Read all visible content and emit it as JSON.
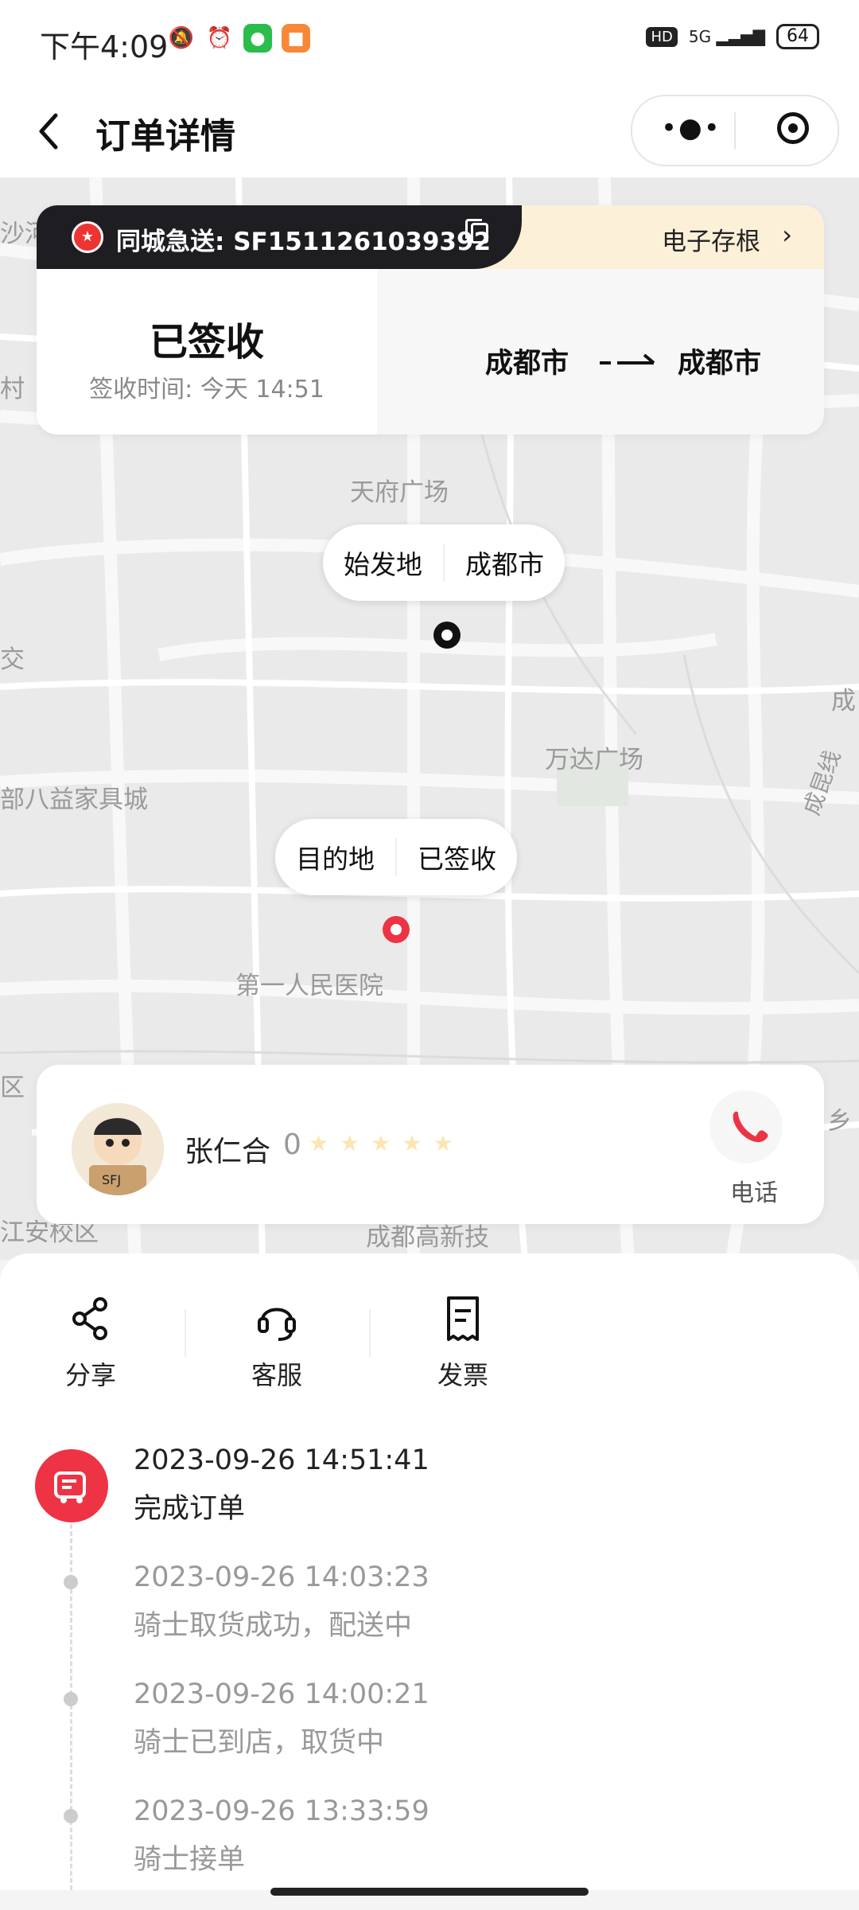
{
  "status_bar": {
    "time": "下午4:09",
    "hd": "HD",
    "network": "5G",
    "battery": "64",
    "icons": [
      "mute-icon",
      "alarm-icon",
      "wechat-icon",
      "app-icon"
    ]
  },
  "header": {
    "title": "订单详情",
    "back_icon": "chevron-left-icon",
    "more_icon": "more-dots-icon",
    "target_icon": "target-icon"
  },
  "order": {
    "code_label": "同城急送: SF1511261039392",
    "receipt_label": "电子存根",
    "status": "已签收",
    "sign_time": "签收时间: 今天 14:51",
    "from_city": "成都市",
    "to_city": "成都市"
  },
  "map": {
    "labels": [
      "天府广场",
      "万达广场",
      "第一人民医院",
      "部八益家具城",
      "沙河",
      "村",
      "交",
      "成",
      "区",
      "江安校区",
      "成都高新技",
      "乡",
      "成昆线"
    ],
    "origin": {
      "title": "始发地",
      "value": "成都市"
    },
    "destination": {
      "title": "目的地",
      "value": "已签收"
    }
  },
  "courier": {
    "name": "张仁合",
    "score": "0",
    "phone_label": "电话"
  },
  "actions": [
    {
      "label": "分享",
      "icon": "share-icon"
    },
    {
      "label": "客服",
      "icon": "headset-icon"
    },
    {
      "label": "发票",
      "icon": "receipt-icon"
    }
  ],
  "timeline": [
    {
      "time": "2023-09-26 14:51:41",
      "desc": "完成订单"
    },
    {
      "time": "2023-09-26 14:03:23",
      "desc": "骑士取货成功，配送中"
    },
    {
      "time": "2023-09-26 14:00:21",
      "desc": "骑士已到店，取货中"
    },
    {
      "time": "2023-09-26 13:33:59",
      "desc": "骑士接单"
    }
  ],
  "colors": {
    "accent_red": "#ee3344",
    "dark_banner": "#1e1e22",
    "cream_banner": "#fdf0d9"
  }
}
